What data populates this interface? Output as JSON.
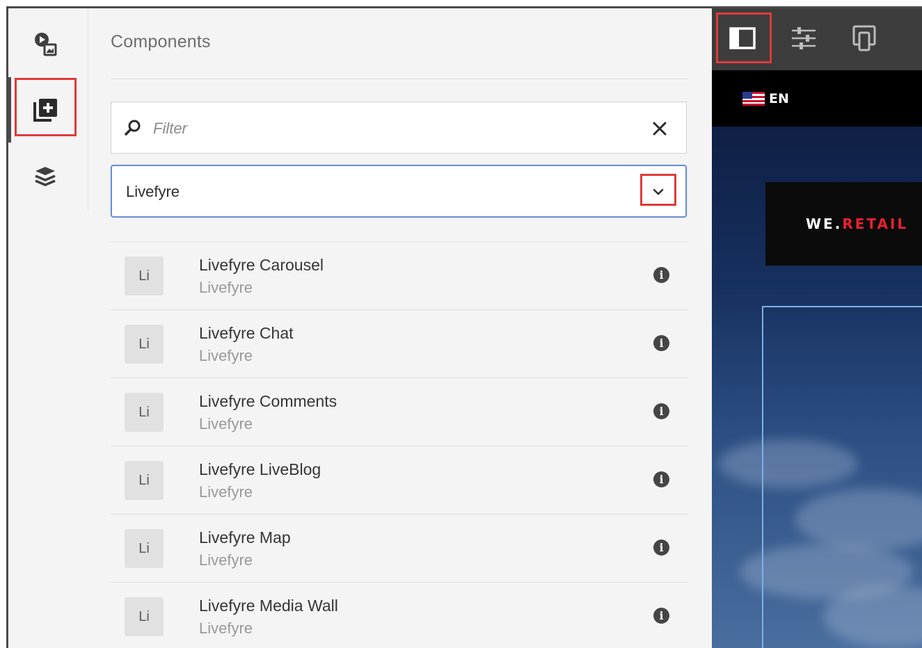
{
  "panel": {
    "title": "Components",
    "filter": {
      "placeholder": "Filter",
      "value": ""
    },
    "group_select": {
      "value": "Livefyre"
    }
  },
  "components": [
    {
      "badge": "Li",
      "title": "Livefyre Carousel",
      "group": "Livefyre"
    },
    {
      "badge": "Li",
      "title": "Livefyre Chat",
      "group": "Livefyre"
    },
    {
      "badge": "Li",
      "title": "Livefyre Comments",
      "group": "Livefyre"
    },
    {
      "badge": "Li",
      "title": "Livefyre LiveBlog",
      "group": "Livefyre"
    },
    {
      "badge": "Li",
      "title": "Livefyre Map",
      "group": "Livefyre"
    },
    {
      "badge": "Li",
      "title": "Livefyre Media Wall",
      "group": "Livefyre"
    }
  ],
  "rail": {
    "items": [
      {
        "icon": "assets-icon",
        "active": false
      },
      {
        "icon": "components-icon",
        "active": true
      },
      {
        "icon": "content-tree-icon",
        "active": false
      }
    ]
  },
  "preview": {
    "toolbar": [
      {
        "icon": "side-panel-toggle-icon",
        "highlighted": true
      },
      {
        "icon": "properties-sliders-icon",
        "highlighted": false
      },
      {
        "icon": "device-emulator-icon",
        "highlighted": false
      }
    ],
    "language": "EN",
    "logo": {
      "part1": "WE.",
      "part2": "RETAIL"
    }
  },
  "colors": {
    "highlight": "#e03a3a",
    "select_border": "#6d8fd0",
    "logo_red": "#e8212f",
    "toolbar": "#3d3d3d"
  }
}
